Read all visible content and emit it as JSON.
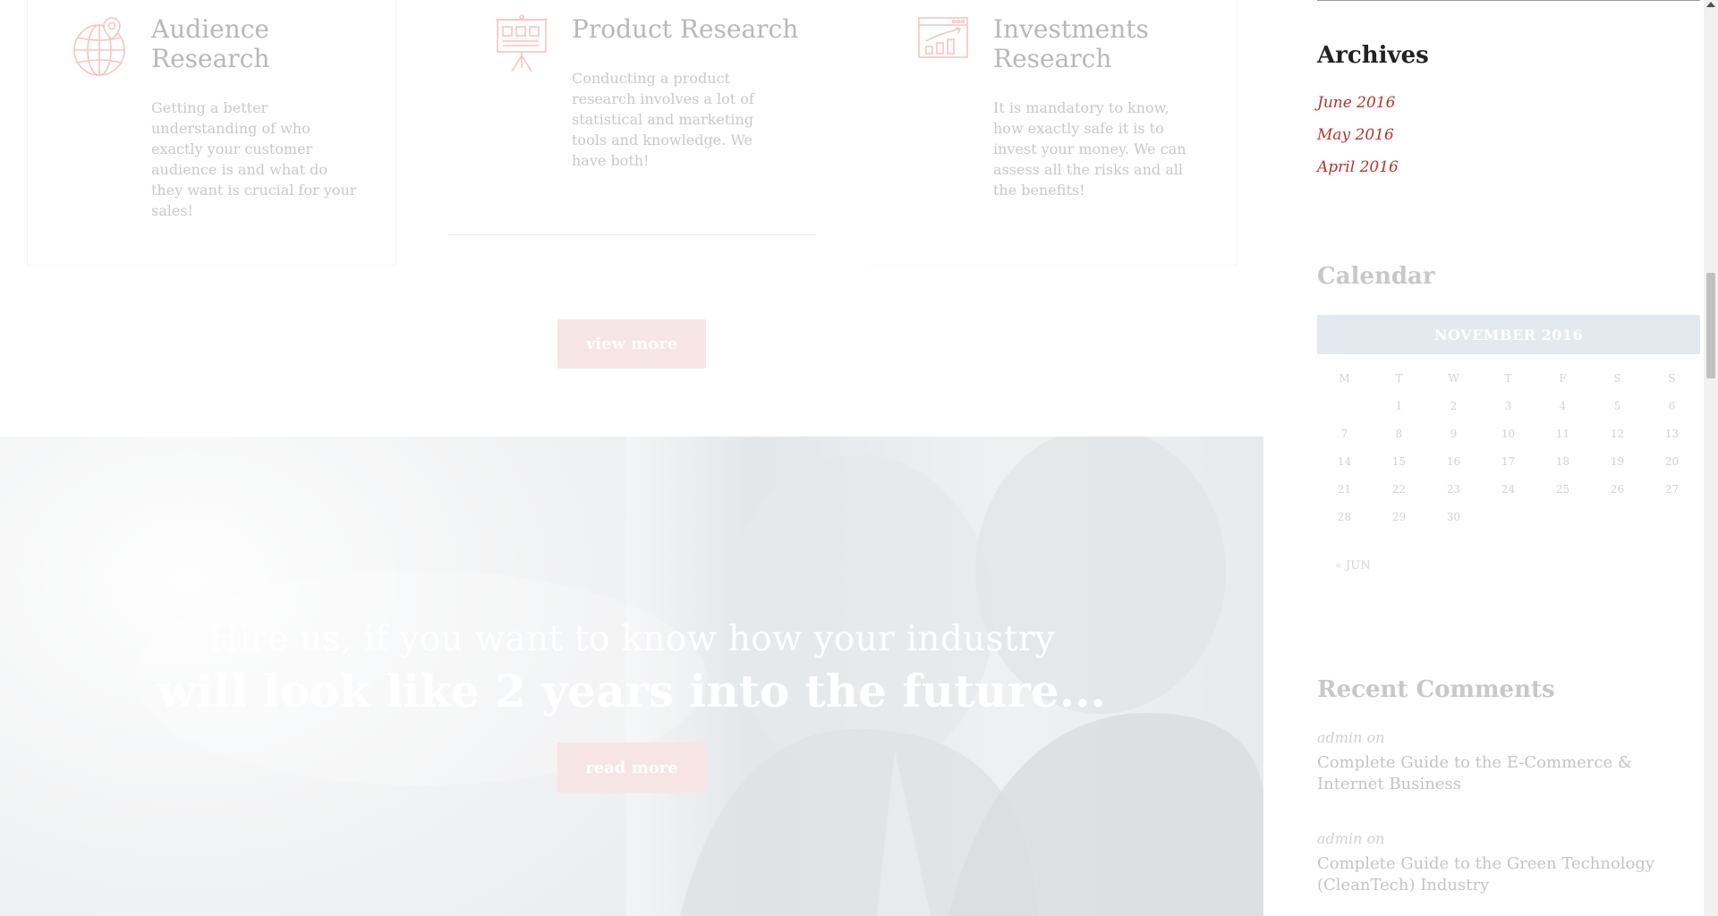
{
  "services": [
    {
      "title": "Audience Research",
      "text": "Getting a better understanding of who exactly your customer audience is and what do they want is crucial for your sales!",
      "icon": "globe-pin-icon"
    },
    {
      "title": "Product Research",
      "text": "Conducting a product research involves a lot of statistical and marketing tools and knowledge. We have both!",
      "icon": "presentation-board-icon"
    },
    {
      "title": "Investments Research",
      "text": "It is mandatory to know, how exactly safe it is to invest your money. We can assess all the risks and all the benefits!",
      "icon": "growth-chart-icon"
    }
  ],
  "view_more_label": "view more",
  "hero": {
    "line1": "Hire us, if you want to know how your industry",
    "line2": "will look like 2 years into the future...",
    "button_label": "read more"
  },
  "sidebar": {
    "archives": {
      "title": "Archives",
      "links": [
        "June 2016",
        "May 2016",
        "April 2016"
      ]
    },
    "calendar": {
      "title": "Calendar",
      "month": "NOVEMBER 2016",
      "weekdays": [
        "M",
        "T",
        "W",
        "T",
        "F",
        "S",
        "S"
      ],
      "weeks": [
        [
          "",
          "1",
          "2",
          "3",
          "4",
          "5",
          "6"
        ],
        [
          "7",
          "8",
          "9",
          "10",
          "11",
          "12",
          "13"
        ],
        [
          "14",
          "15",
          "16",
          "17",
          "18",
          "19",
          "20"
        ],
        [
          "21",
          "22",
          "23",
          "24",
          "25",
          "26",
          "27"
        ],
        [
          "28",
          "29",
          "30",
          "",
          "",
          "",
          ""
        ]
      ],
      "prev_link": "« JUN"
    },
    "recent_comments": {
      "title": "Recent Comments",
      "items": [
        {
          "author": "admin on",
          "post": "Complete Guide to the E-Commerce & Internet Business"
        },
        {
          "author": "admin on",
          "post": "Complete Guide to the Green Technology (CleanTech) Industry"
        }
      ]
    }
  },
  "colors": {
    "accent": "#b5352c",
    "button_bg": "#f7e5e5",
    "calendar_header": "#e3e9ee",
    "icon_stroke": "#f4c4c4"
  }
}
